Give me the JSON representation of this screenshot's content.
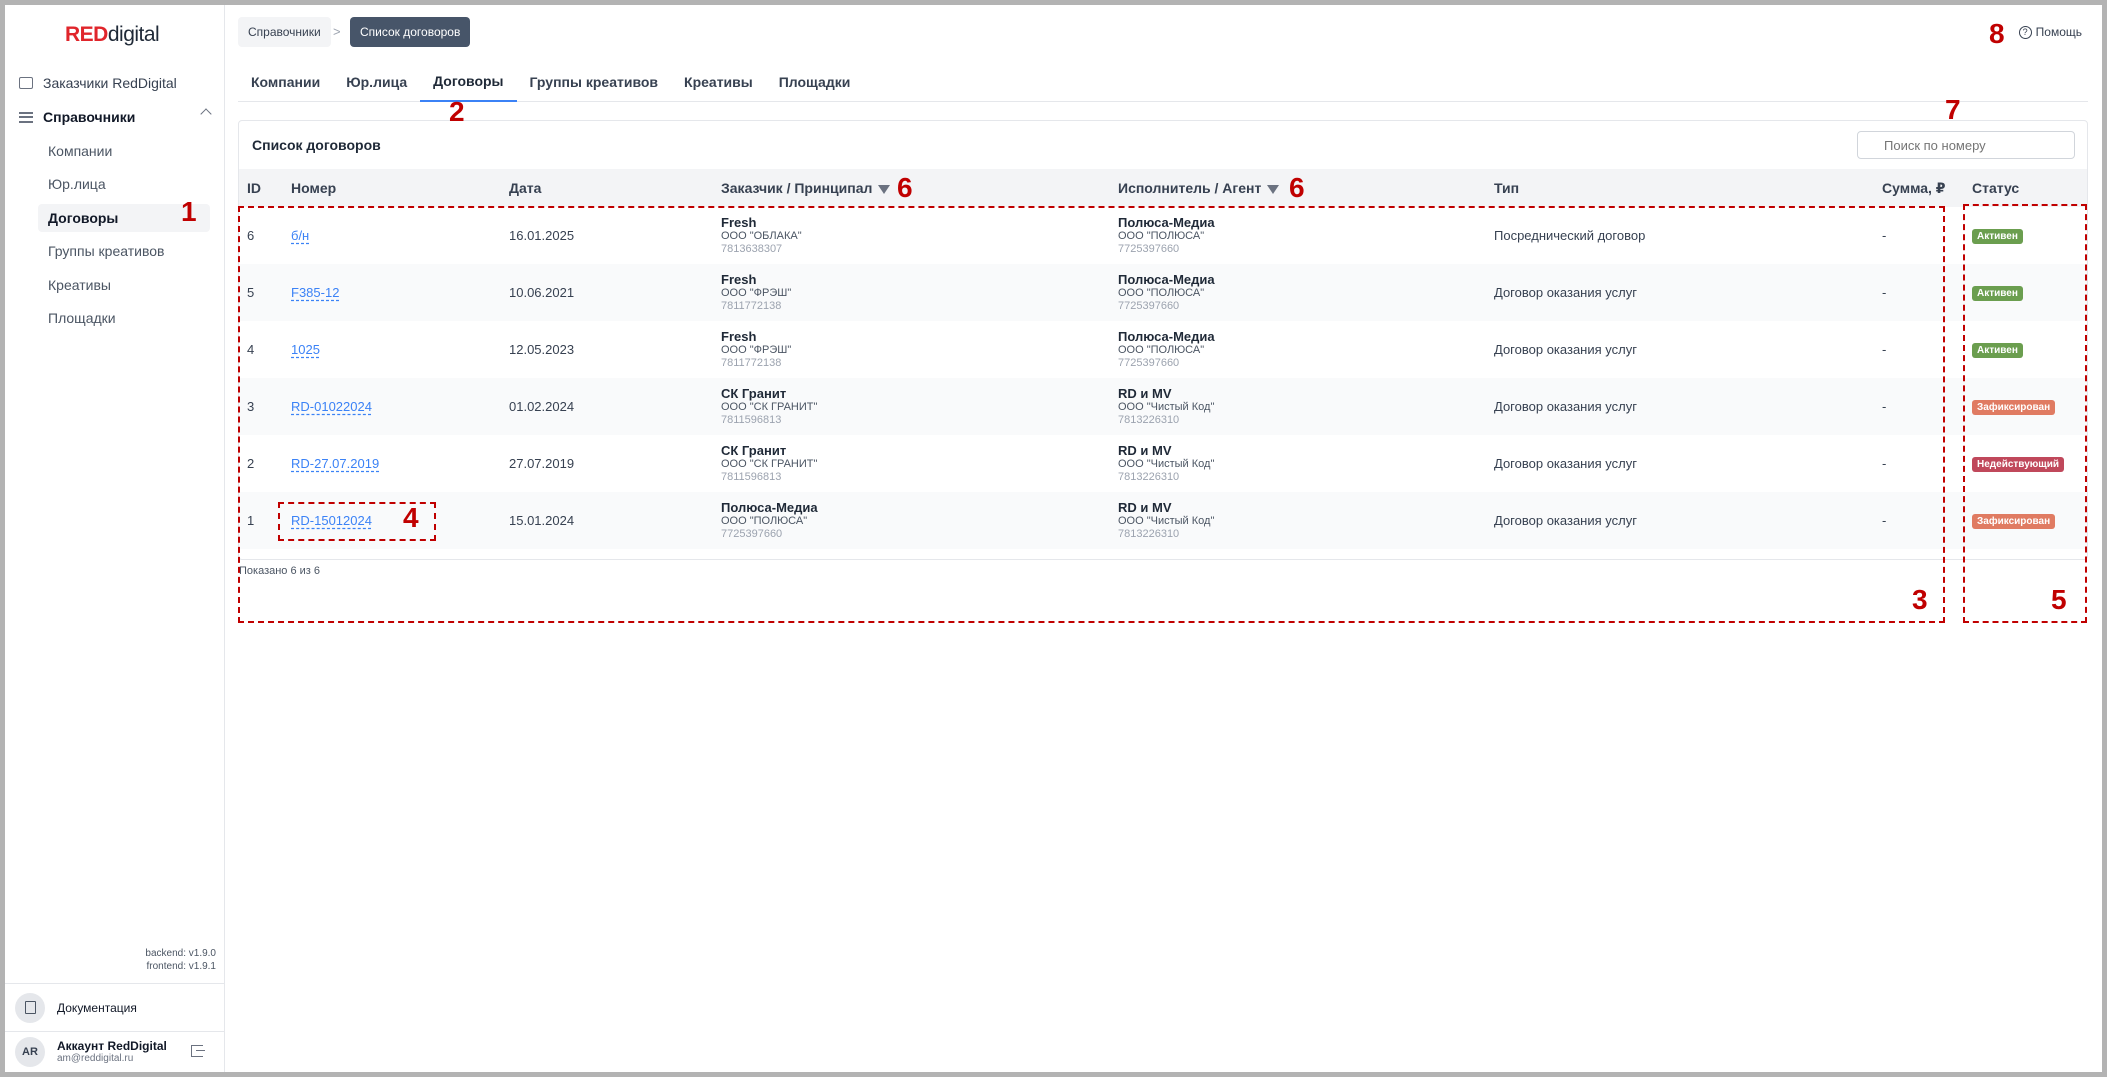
{
  "sidebar": {
    "logo_red": "RED",
    "logo_rest": "digital",
    "top_item": "Заказчики RedDigital",
    "group": "Справочники",
    "items": [
      "Компании",
      "Юр.лица",
      "Договоры",
      "Группы креативов",
      "Креативы",
      "Площадки"
    ],
    "active_item": "Договоры",
    "version_backend": "backend: v1.9.0",
    "version_frontend": "frontend: v1.9.1",
    "docs_label": "Документация",
    "account_initials": "AR",
    "account_name": "Аккаунт RedDigital",
    "account_email": "am@reddigital.ru"
  },
  "breadcrumb": {
    "first": "Справочники",
    "separator": ">",
    "current": "Список договоров"
  },
  "help_label": "Помощь",
  "tabs": [
    "Компании",
    "Юр.лица",
    "Договоры",
    "Группы креативов",
    "Креативы",
    "Площадки"
  ],
  "active_tab": "Договоры",
  "card": {
    "title": "Список договоров",
    "search_placeholder": "Поиск по номеру",
    "columns": [
      "ID",
      "Номер",
      "Дата",
      "Заказчик / Принципал",
      "Исполнитель / Агент",
      "Тип",
      "Сумма, ₽",
      "Статус"
    ],
    "rows": [
      {
        "id": "6",
        "number": "б/н",
        "date": "16.01.2025",
        "client": {
          "name": "Fresh",
          "org": "ООО \"ОБЛАКА\"",
          "inn": "7813638307"
        },
        "agent": {
          "name": "Полюса-Медиа",
          "org": "ООО \"ПОЛЮСА\"",
          "inn": "7725397660"
        },
        "type": "Посреднический договор",
        "sum": "-",
        "status": "Активен"
      },
      {
        "id": "5",
        "number": "F385-12",
        "date": "10.06.2021",
        "client": {
          "name": "Fresh",
          "org": "ООО \"ФРЭШ\"",
          "inn": "7811772138"
        },
        "agent": {
          "name": "Полюса-Медиа",
          "org": "ООО \"ПОЛЮСА\"",
          "inn": "7725397660"
        },
        "type": "Договор оказания услуг",
        "sum": "-",
        "status": "Активен"
      },
      {
        "id": "4",
        "number": "1025",
        "date": "12.05.2023",
        "client": {
          "name": "Fresh",
          "org": "ООО \"ФРЭШ\"",
          "inn": "7811772138"
        },
        "agent": {
          "name": "Полюса-Медиа",
          "org": "ООО \"ПОЛЮСА\"",
          "inn": "7725397660"
        },
        "type": "Договор оказания услуг",
        "sum": "-",
        "status": "Активен"
      },
      {
        "id": "3",
        "number": "RD-01022024",
        "date": "01.02.2024",
        "client": {
          "name": "СК Гранит",
          "org": "ООО \"СК ГРАНИТ\"",
          "inn": "7811596813"
        },
        "agent": {
          "name": "RD и MV",
          "org": "ООО \"Чистый Код\"",
          "inn": "7813226310"
        },
        "type": "Договор оказания услуг",
        "sum": "-",
        "status": "Зафиксирован"
      },
      {
        "id": "2",
        "number": "RD-27.07.2019",
        "date": "27.07.2019",
        "client": {
          "name": "СК Гранит",
          "org": "ООО \"СК ГРАНИТ\"",
          "inn": "7811596813"
        },
        "agent": {
          "name": "RD и MV",
          "org": "ООО \"Чистый Код\"",
          "inn": "7813226310"
        },
        "type": "Договор оказания услуг",
        "sum": "-",
        "status": "Недействующий"
      },
      {
        "id": "1",
        "number": "RD-15012024",
        "date": "15.01.2024",
        "client": {
          "name": "Полюса-Медиа",
          "org": "ООО \"ПОЛЮСА\"",
          "inn": "7725397660"
        },
        "agent": {
          "name": "RD и MV",
          "org": "ООО \"Чистый Код\"",
          "inn": "7813226310"
        },
        "type": "Договор оказания услуг",
        "sum": "-",
        "status": "Зафиксирован"
      }
    ],
    "footer": "Показано 6 из 6"
  },
  "status_colors": {
    "Активен": "#6b9e4f",
    "Зафиксирован": "#e07b62",
    "Недействующий": "#c0485b"
  },
  "annotations": [
    "1",
    "2",
    "3",
    "4",
    "5",
    "6",
    "6",
    "7",
    "8"
  ],
  "annotation_color": "#c00000"
}
